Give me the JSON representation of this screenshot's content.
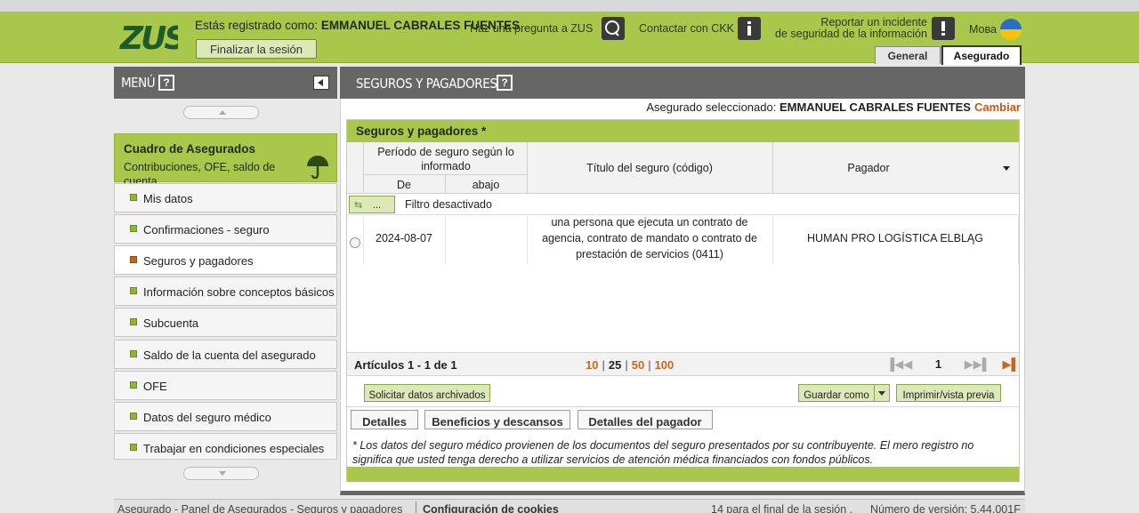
{
  "header": {
    "logo_text": "ZUS",
    "registered_label": "Estás registrado como:",
    "registered_user": "EMMANUEL CABRALES FUENTES",
    "logout_label": "Finalizar la sesión",
    "ask_label": "Haz una pregunta a ZUS",
    "contact_label": "Contactar con CKK",
    "report_line1": "Reportar un incidente",
    "report_line2": "de seguridad de la información",
    "language_label": "Мова",
    "tabs": [
      {
        "label": "General",
        "active": false
      },
      {
        "label": "Asegurado",
        "active": true
      }
    ]
  },
  "sidebar": {
    "title": "MENÚ",
    "help": "?",
    "box": {
      "title": "Cuadro de Asegurados",
      "subtitle": "Contribuciones, OFE, saldo de cuenta"
    },
    "items": [
      {
        "label": "Mis datos",
        "active": false
      },
      {
        "label": "Confirmaciones - seguro",
        "active": false
      },
      {
        "label": "Seguros y pagadores",
        "active": true
      },
      {
        "label": "Información sobre conceptos básicos y",
        "active": false
      },
      {
        "label": "Subcuenta",
        "active": false
      },
      {
        "label": "Saldo de la cuenta del asegurado",
        "active": false
      },
      {
        "label": "OFE",
        "active": false
      },
      {
        "label": "Datos del seguro médico",
        "active": false
      },
      {
        "label": "Trabajar en condiciones especiales",
        "active": false
      }
    ]
  },
  "main": {
    "title": "SEGUROS Y PAGADORES",
    "help": "?",
    "selected_label": "Asegurado seleccionado:",
    "selected_user": "EMMANUEL CABRALES FUENTES",
    "change_label": "Cambiar",
    "panel_title": "Seguros y pagadores *",
    "columns": {
      "period": "Período de seguro según lo informado",
      "from": "De",
      "to": "abajo",
      "title": "Título del seguro (código)",
      "payer": "Pagador"
    },
    "filter_button": "...",
    "filter_status": "Filtro desactivado",
    "rows": [
      {
        "from": "2024-08-07",
        "to": "",
        "title": "una persona que ejecuta un contrato de agencia, contrato de mandato o contrato de prestación de servicios (0411)",
        "payer": "HUMAN PRO LOGÍSTICA ELBLĄG"
      }
    ],
    "count_label": "Artículos 1 - 1 de 1",
    "page_sizes": [
      "10",
      "25",
      "50",
      "100"
    ],
    "current_page_size": "25",
    "page_number": "1",
    "buttons": {
      "archive": "Solicitar datos archivados",
      "save_as": "Guardar como",
      "print": "Imprimir/vista previa",
      "details": "Detalles",
      "benefits": "Beneficios y descansos",
      "payer_details": "Detalles del pagador"
    },
    "note": "* Los datos del seguro médico provienen de los documentos del seguro presentados por su contribuyente. El mero registro no significa que usted tenga derecho a utilizar servicios de atención médica financiados con fondos públicos."
  },
  "footer": {
    "breadcrumb": "Asegurado - Panel de Asegurados - Seguros y pagadores",
    "cookies": "Configuración de cookies",
    "session": "14 para el final de la sesión .",
    "version": "Número de versión: 5.44.001F"
  },
  "colors": {
    "brand_green": "#a9c74a",
    "header_gray": "#666666",
    "accent_orange": "#c46a1f"
  }
}
